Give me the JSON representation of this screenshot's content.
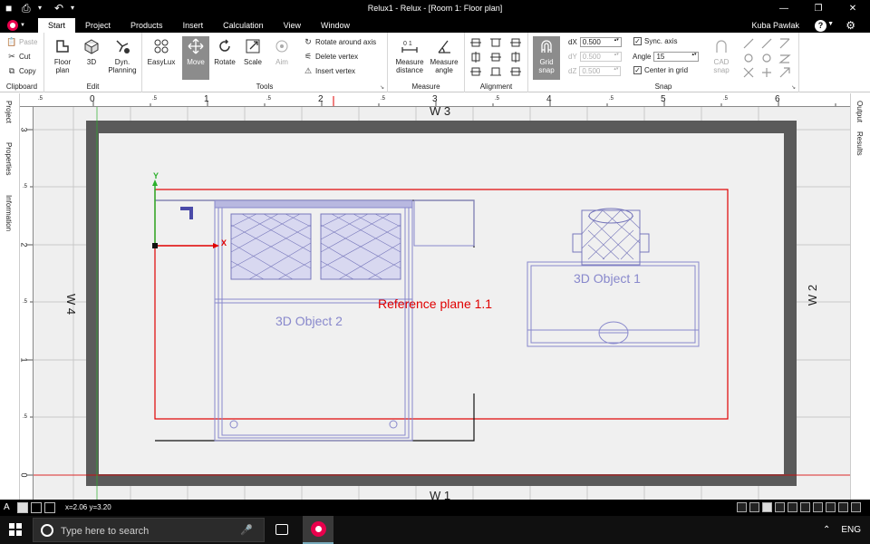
{
  "window": {
    "title": "Relux1 - Relux - [Room 1: Floor plan]",
    "user": "Kuba Pawlak",
    "help": "?",
    "controls": [
      "—",
      "❐",
      "✕"
    ]
  },
  "tabs": [
    "Start",
    "Project",
    "Products",
    "Insert",
    "Calculation",
    "View",
    "Window"
  ],
  "ribbon": {
    "clipboard": {
      "label": "Clipboard",
      "paste": "Paste",
      "cut": "Cut",
      "copy": "Copy"
    },
    "edit": {
      "label": "Edit",
      "floor_plan": "Floor plan",
      "three_d": "3D",
      "dyn_planning": "Dyn. Planning"
    },
    "tools": {
      "label": "Tools",
      "easylux": "EasyLux",
      "move": "Move",
      "rotate": "Rotate",
      "scale": "Scale",
      "aim": "Aim",
      "rotate_axis": "Rotate around axis",
      "delete_vertex": "Delete vertex",
      "insert_vertex": "Insert vertex"
    },
    "measure": {
      "label": "Measure",
      "distance": "Measure distance",
      "angle": "Measure angle"
    },
    "alignment": {
      "label": "Alignment"
    },
    "snap": {
      "label": "Snap",
      "grid_snap": "Grid snap",
      "dx_label": "dX",
      "dx_value": "0.500",
      "dy_label": "dY",
      "dy_value": "0.500",
      "dz_label": "dZ",
      "dz_value": "0.500",
      "sync_axis": "Sync. axis",
      "angle_label": "Angle",
      "angle_value": "15",
      "center_in_grid": "Center in grid",
      "cad_snap": "CAD snap"
    }
  },
  "left_panel": [
    "Project",
    "Properties",
    "Information"
  ],
  "right_panel": [
    "Output",
    "Results"
  ],
  "ruler": {
    "h_labels": [
      "0",
      "1",
      "2",
      "3",
      "4",
      "5",
      "6"
    ],
    "v_labels": [
      "3",
      "2",
      "1",
      "0"
    ],
    "h_half": ".5",
    "v_half": ".5"
  },
  "floor_plan": {
    "walls": [
      "W 3",
      "W 2",
      "W 1",
      "W 4"
    ],
    "reference_plane": "Reference plane 1.1",
    "object_1": "3D Object  1",
    "object_2": "3D Object  2",
    "axis_x": "X",
    "axis_y": "Y"
  },
  "status": {
    "coords": "x=2.06 y=3.20"
  },
  "taskbar": {
    "search_placeholder": "Type here to search",
    "lang": "ENG"
  },
  "colors": {
    "accent": "#e8004c",
    "reference": "#e00000",
    "object": "#8888cc",
    "wall": "#5a5a5a"
  }
}
